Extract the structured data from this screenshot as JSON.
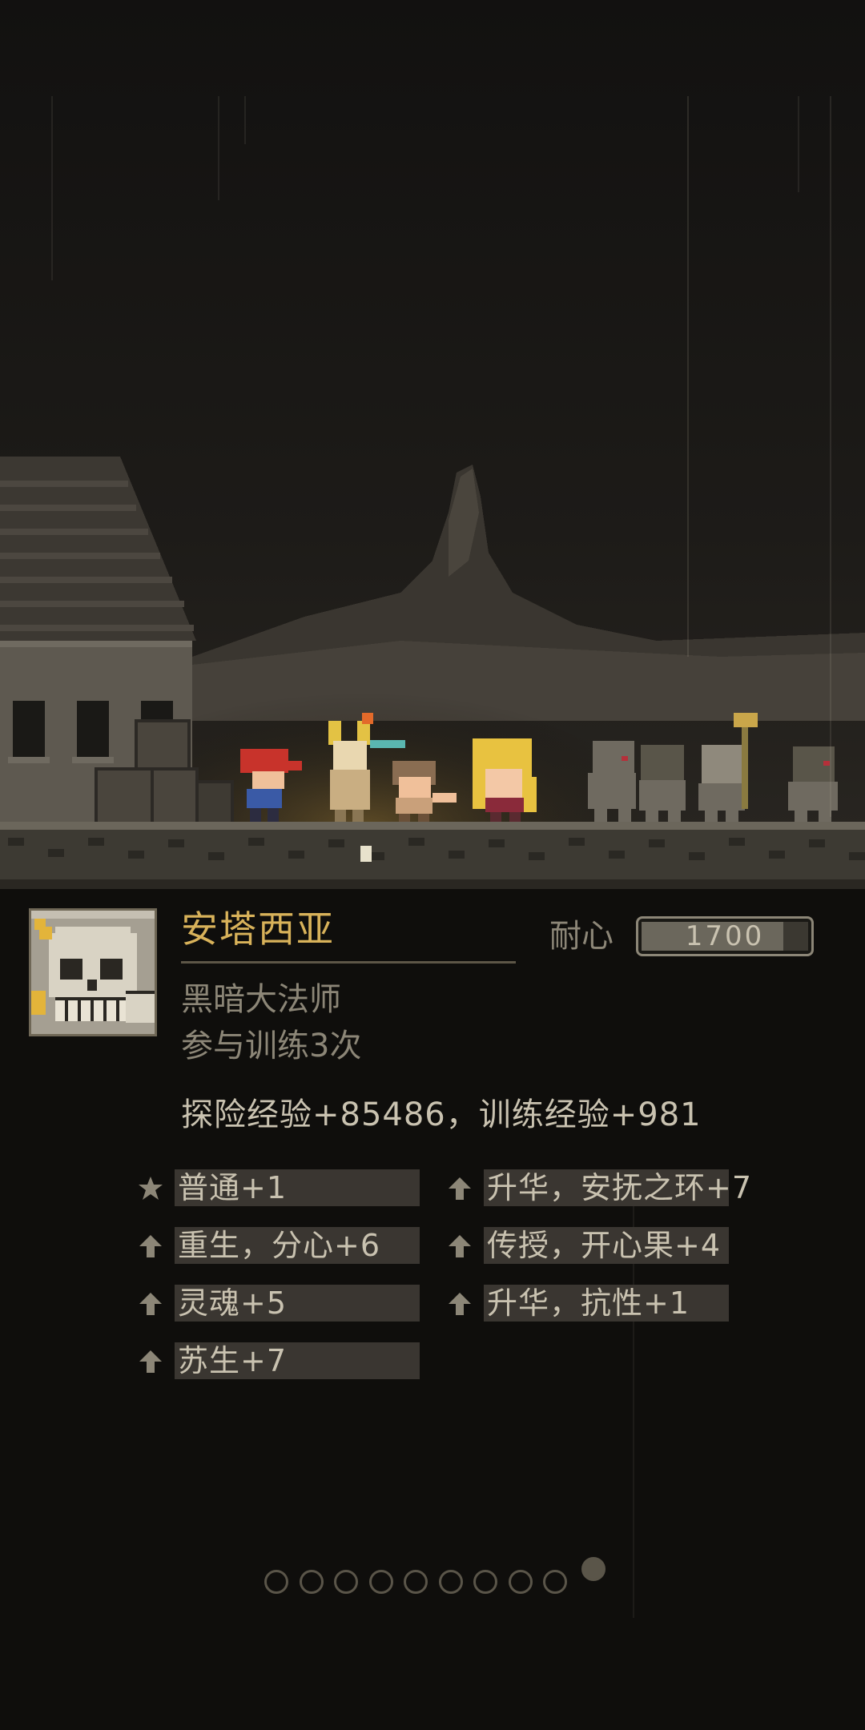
{
  "hero": {
    "name": "安塔西亚",
    "class": "黑暗大法师",
    "training": "参与训练3次",
    "portrait_icon": "skull-horned-portrait"
  },
  "stat": {
    "label": "耐心",
    "value": "1700",
    "fill_fraction": 0.85
  },
  "exp_line": "探险经验+85486，训练经验+981",
  "skills": [
    {
      "icon": "star-icon",
      "label": "普通+1"
    },
    {
      "icon": "up-arrow-icon",
      "label": "升华，安抚之环+7"
    },
    {
      "icon": "up-arrow-icon",
      "label": "重生，分心+6"
    },
    {
      "icon": "up-arrow-icon",
      "label": "传授，开心果+4"
    },
    {
      "icon": "up-arrow-icon",
      "label": "灵魂+5"
    },
    {
      "icon": "up-arrow-icon",
      "label": "升华，抗性+1"
    },
    {
      "icon": "up-arrow-icon",
      "label": "苏生+7"
    }
  ],
  "pager": {
    "total": 10,
    "active_index": 9
  },
  "colors": {
    "background": "#0f0e0c",
    "gold_text": "#d8b25a",
    "muted_text": "#8c8677",
    "light_text": "#c9c2b0",
    "skill_box": "#3a3631"
  }
}
